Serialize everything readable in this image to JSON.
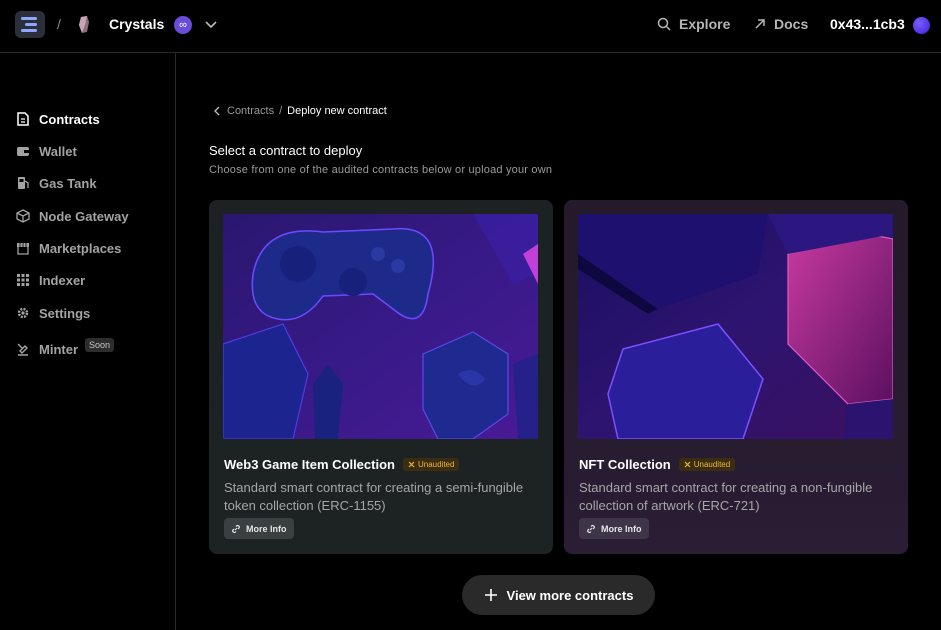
{
  "topbar": {
    "separator": "/",
    "project_name": "Crystals",
    "nav": [
      {
        "label": "Explore",
        "icon": "search-icon"
      },
      {
        "label": "Docs",
        "icon": "external-arrow-icon"
      }
    ],
    "account": "0x43...1cb3"
  },
  "sidebar": {
    "items": [
      {
        "label": "Contracts",
        "icon": "contract-file-icon",
        "active": true
      },
      {
        "label": "Wallet",
        "icon": "wallet-icon"
      },
      {
        "label": "Gas Tank",
        "icon": "gas-pump-icon"
      },
      {
        "label": "Node Gateway",
        "icon": "cube-icon"
      },
      {
        "label": "Marketplaces",
        "icon": "storefront-icon"
      },
      {
        "label": "Indexer",
        "icon": "grid-icon"
      },
      {
        "label": "Settings",
        "icon": "gear-icon"
      },
      {
        "label": "Minter",
        "icon": "minter-icon",
        "badge": "Soon"
      }
    ]
  },
  "breadcrumb": {
    "parent": "Contracts",
    "separator": "/",
    "current": "Deploy new contract"
  },
  "heading": {
    "title": "Select a contract to deploy",
    "subtitle": "Choose from one of the audited contracts below or upload your own"
  },
  "cards": [
    {
      "title": "Web3 Game Item Collection",
      "badge": "Unaudited",
      "description": "Standard smart contract for creating a semi-fungible token collection (ERC-1155)",
      "button": "More Info"
    },
    {
      "title": "NFT Collection",
      "badge": "Unaudited",
      "description": "Standard smart contract for creating a non-fungible collection of artwork (ERC-721)",
      "button": "More Info"
    }
  ],
  "view_more": "View more contracts",
  "colors": {
    "accent": "#6b4bd8",
    "badge_text": "#f0b43c",
    "background": "#000000"
  }
}
